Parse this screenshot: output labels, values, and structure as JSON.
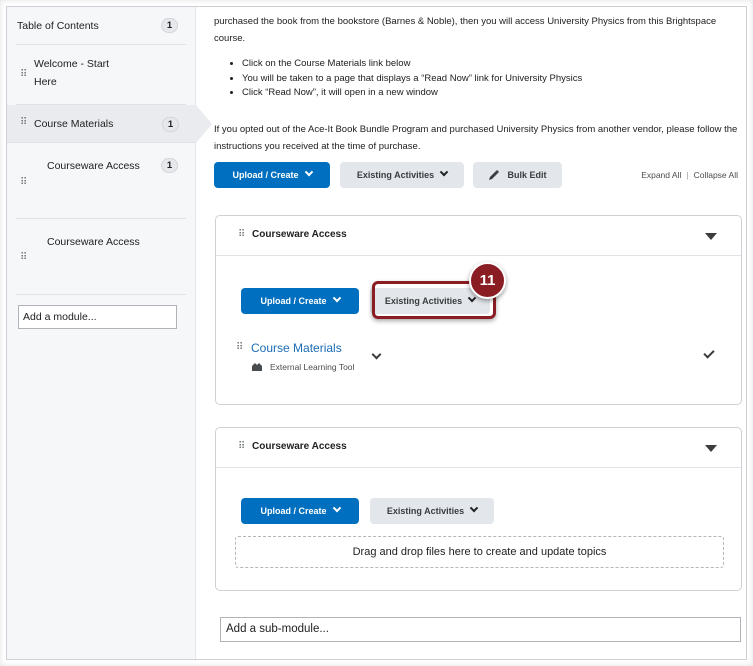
{
  "sidebar": {
    "toc": {
      "label": "Table of Contents",
      "count": "1"
    },
    "items": [
      {
        "label_line1": "Welcome - Start",
        "label_line2": "Here"
      },
      {
        "label": "Course Materials",
        "count": "1"
      },
      {
        "label": "Courseware Access",
        "count": "1"
      },
      {
        "label": "Courseware Access"
      }
    ],
    "add_module_placeholder": "Add a module..."
  },
  "main": {
    "intro_line1": "purchased the book from the bookstore (Barnes & Noble), then you will access University Physics from this Brightspace",
    "intro_line2": "course.",
    "bullets": [
      "Click on the Course Materials link below",
      "You will be taken to a page that displays a “Read Now” link for University Physics",
      "Click “Read Now”, it will open in a new window"
    ],
    "optout_line1": "If you opted out of the Ace-It Book Bundle Program and purchased University Physics from another vendor, please follow the",
    "optout_line2": "instructions you received at the time of purchase.",
    "toolbar": {
      "upload_label": "Upload / Create",
      "existing_label": "Existing Activities",
      "bulk_label": "Bulk Edit",
      "expand_all": "Expand All",
      "separator": "|",
      "collapse_all": "Collapse All"
    },
    "submodules": [
      {
        "title": "Courseware Access",
        "upload_label": "Upload / Create",
        "existing_label": "Existing Activities",
        "topic": {
          "title": "Course Materials",
          "type": "External Learning Tool"
        }
      },
      {
        "title": "Courseware Access",
        "upload_label": "Upload / Create",
        "existing_label": "Existing Activities",
        "dropzone": "Drag and drop files here to create and update topics"
      }
    ],
    "add_submodule_placeholder": "Add a sub-module..."
  },
  "annotation": {
    "step": "11",
    "color": "#8a1d24"
  },
  "colors": {
    "primary": "#006fbf",
    "link": "#1b6cb5"
  }
}
